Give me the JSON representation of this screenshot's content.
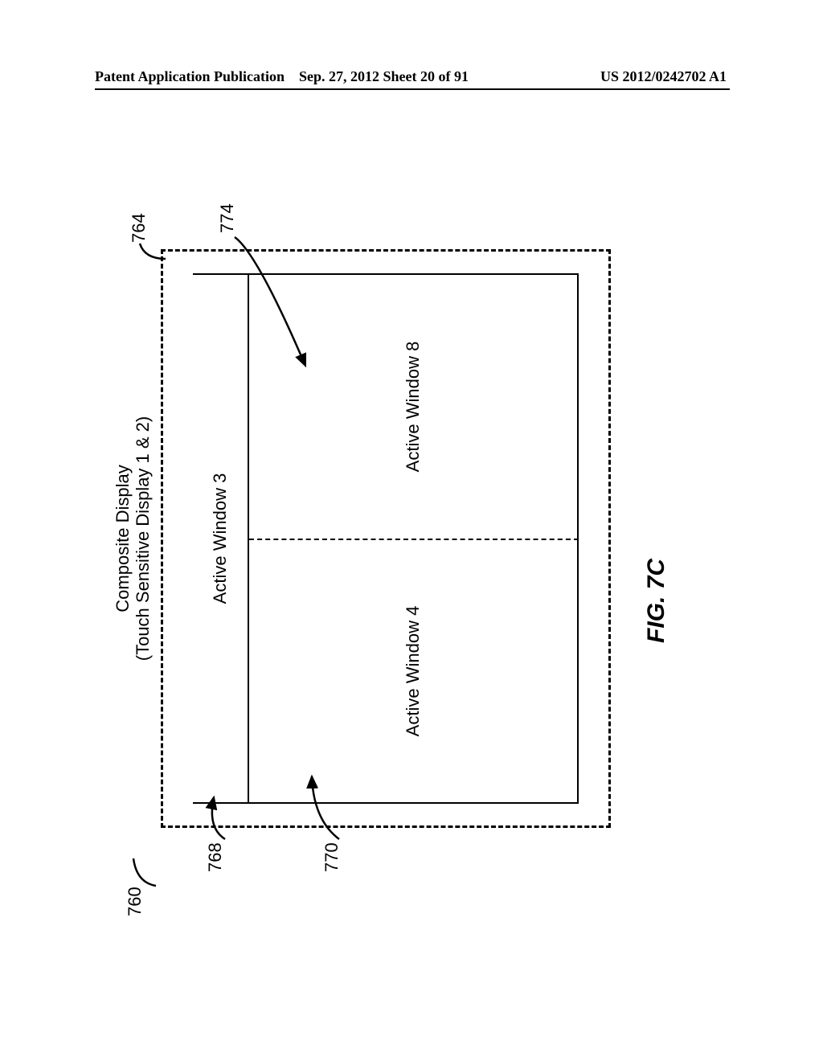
{
  "header": {
    "left": "Patent Application Publication",
    "center": "Sep. 27, 2012  Sheet 20 of 91",
    "right": "US 2012/0242702 A1"
  },
  "title": {
    "line1": "Composite Display",
    "line2": "(Touch Sensitive Display 1 & 2)"
  },
  "windows": {
    "top": "Active Window 3",
    "left": "Active Window 4",
    "right": "Active Window 8"
  },
  "refs": {
    "r760": "760",
    "r764": "764",
    "r768": "768",
    "r770": "770",
    "r774": "774"
  },
  "caption": "FIG. 7C"
}
